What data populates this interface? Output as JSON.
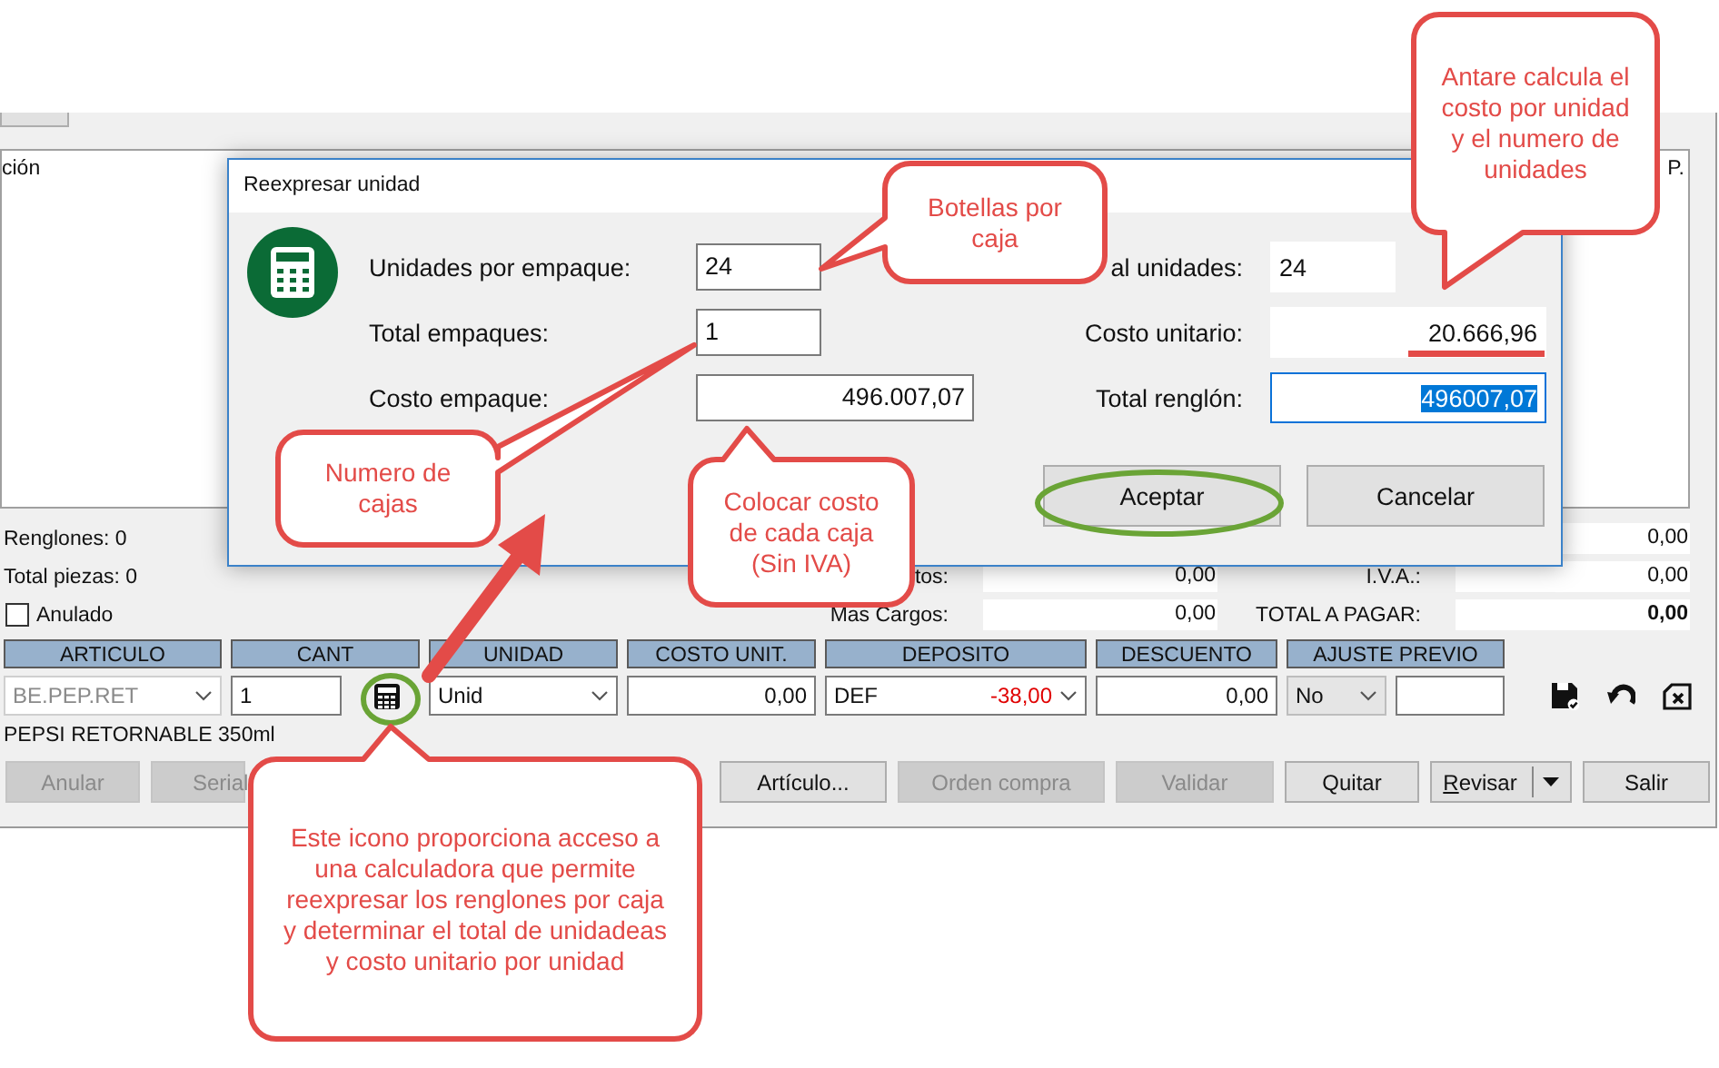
{
  "window": {
    "grid": {
      "columns": [
        "ción",
        "P."
      ]
    },
    "summary": {
      "left": [
        {
          "kind": "text",
          "label": "Renglones: 0"
        },
        {
          "kind": "text",
          "label": "Total piezas: 0"
        },
        {
          "kind": "checkbox",
          "label": "Anulado",
          "checked": false
        }
      ],
      "middle": [
        {
          "label": "tos:",
          "value": "0,00"
        },
        {
          "label": "Mas Cargos:",
          "value": "0,00"
        }
      ],
      "right": [
        {
          "value": "0,00",
          "bold": false
        },
        {
          "label": "I.V.A.:",
          "value": "0,00",
          "bold": false
        },
        {
          "label": "TOTAL A PAGAR:",
          "value": "0,00",
          "bold": true
        }
      ]
    },
    "entry": [
      {
        "header": "ARTICULO",
        "kind": "combo",
        "value": "BE.PEP.RET",
        "disabled": true
      },
      {
        "header": "CANT",
        "kind": "input",
        "value": "1",
        "calculator": true
      },
      {
        "header": "UNIDAD",
        "kind": "select",
        "value": "Unid"
      },
      {
        "header": "COSTO UNIT.",
        "kind": "number",
        "value": "0,00"
      },
      {
        "header": "DEPOSITO",
        "kind": "select",
        "value": "DEF",
        "extra": "-38,00"
      },
      {
        "header": "DESCUENTO",
        "kind": "number",
        "value": "0,00"
      },
      {
        "header": "AJUSTE PREVIO",
        "kind": "split",
        "value": "No"
      }
    ],
    "row_actions": [
      {
        "kind": "save"
      },
      {
        "kind": "undo"
      },
      {
        "kind": "delete"
      }
    ],
    "description": "PEPSI RETORNABLE 350ml",
    "buttons": [
      {
        "label": "Anular",
        "disabled": true
      },
      {
        "label": "Serial",
        "disabled": true
      },
      {
        "kind": "gap"
      },
      {
        "label": "Artículo...",
        "disabled": false
      },
      {
        "label": "Orden compra",
        "disabled": true
      },
      {
        "label": "Validar",
        "disabled": true
      },
      {
        "label": "Quitar",
        "disabled": false
      },
      {
        "label": "Revisar",
        "disabled": false,
        "dropdown": true,
        "mnemonic": true
      },
      {
        "label": "Salir",
        "disabled": false
      }
    ]
  },
  "dialog": {
    "title": "Reexpresar unidad",
    "left_fields": [
      {
        "label": "Unidades por empaque:",
        "value": "24",
        "wide": false
      },
      {
        "label": "Total empaques:",
        "value": "1",
        "wide": false
      },
      {
        "label": "Costo empaque:",
        "value": "496.007,07",
        "wide": true
      }
    ],
    "right_fields": [
      {
        "label": "al unidades:",
        "value": "24",
        "wide": false,
        "focused": false,
        "text_selected": false
      },
      {
        "label": "Costo unitario:",
        "value": "20.666,96",
        "wide": true,
        "focused": false,
        "text_selected": false
      },
      {
        "label": "Total renglón:",
        "value": "496007,07",
        "wide": true,
        "focused": true,
        "text_selected": true
      }
    ],
    "buttons": [
      {
        "label": "Aceptar"
      },
      {
        "label": "Cancelar"
      }
    ]
  },
  "callouts": [
    {
      "text": "Botellas por caja"
    },
    {
      "text": "Antare calcula el costo por unidad y el numero de unidades"
    },
    {
      "text": "Numero de cajas"
    },
    {
      "text": "Colocar costo de cada caja (Sin IVA)"
    },
    {
      "text": "Este icono proporciona acceso a una calculadora que permite reexpresar los renglones por caja y determinar el total de unidadeas y costo unitario por unidad"
    }
  ]
}
